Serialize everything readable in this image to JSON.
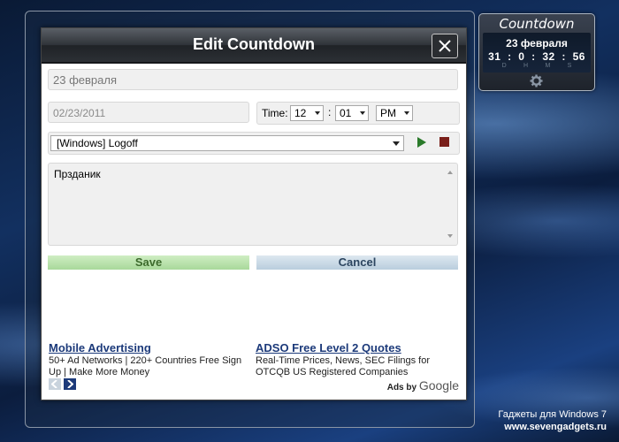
{
  "dialog": {
    "title": "Edit Countdown",
    "name_value": "23 февраля",
    "date_value": "02/23/2011",
    "time_label": "Time:",
    "hour": "12",
    "minute": "01",
    "ampm": "PM",
    "action": "[Windows] Logoff",
    "notes": "Прзданик",
    "save_label": "Save",
    "cancel_label": "Cancel"
  },
  "ads": [
    {
      "title": "Mobile Advertising",
      "body": "50+ Ad Networks | 220+ Countries Free Sign Up | Make More Money"
    },
    {
      "title": "ADSO Free Level 2 Quotes",
      "body": "Real-Time Prices, News, SEC Filings for OTCQB US Registered Companies"
    }
  ],
  "ads_by": "Ads by",
  "google": "Google",
  "gadget": {
    "title": "Countdown",
    "date": "23 февраля",
    "days": "31",
    "hours": "0",
    "minutes": "32",
    "seconds": "56",
    "units": [
      "D",
      "H",
      "M",
      "S"
    ]
  },
  "footer": {
    "line1": "Гаджеты для Windows 7",
    "line2": "www.sevengadgets.ru"
  },
  "colors": {
    "save": "#a8d89a",
    "cancel": "#b9cddd",
    "ad_link": "#1c3a7a"
  }
}
